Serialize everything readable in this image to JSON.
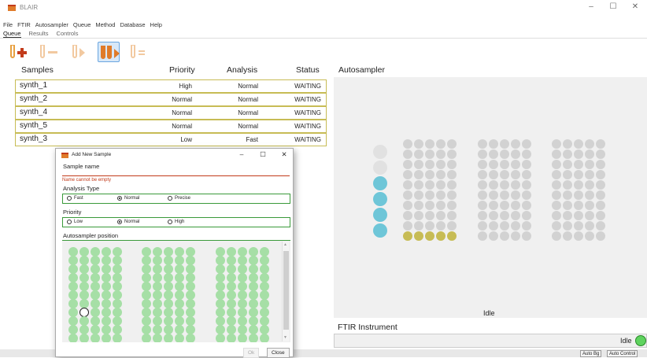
{
  "window": {
    "title": "BLAIR"
  },
  "menu": [
    "File",
    "FTIR",
    "Autosampler",
    "Queue",
    "Method",
    "Database",
    "Help"
  ],
  "tabs": [
    {
      "label": "Queue",
      "active": true
    },
    {
      "label": "Results",
      "active": false
    },
    {
      "label": "Controls",
      "active": false
    }
  ],
  "toolbar": {
    "buttons": [
      "add-sample",
      "remove-sample",
      "run-next",
      "run-all",
      "method"
    ],
    "selected": "run-all"
  },
  "queue_table": {
    "headers": {
      "samples": "Samples",
      "priority": "Priority",
      "analysis": "Analysis",
      "status": "Status"
    },
    "rows": [
      {
        "name": "synth_1",
        "priority": "High",
        "analysis": "Normal",
        "status": "WAITING"
      },
      {
        "name": "synth_2",
        "priority": "Normal",
        "analysis": "Normal",
        "status": "WAITING"
      },
      {
        "name": "synth_4",
        "priority": "Normal",
        "analysis": "Normal",
        "status": "WAITING"
      },
      {
        "name": "synth_5",
        "priority": "Normal",
        "analysis": "Normal",
        "status": "WAITING"
      },
      {
        "name": "synth_3",
        "priority": "Low",
        "analysis": "Fast",
        "status": "WAITING"
      }
    ]
  },
  "autosampler": {
    "title": "Autosampler",
    "status": "Idle",
    "colors": {
      "empty": "#d2d2d2",
      "large_empty": "#e1e1e1",
      "large_filled": "#6ec6d8",
      "queued": "#c7bc55"
    }
  },
  "ftir": {
    "title": "FTIR Instrument",
    "status": "Idle",
    "status_color": "#5fd35f"
  },
  "status_buttons": [
    "Auto Bg",
    "Auto Control"
  ],
  "dialog": {
    "title": "Add New Sample",
    "sample_name_label": "Sample name",
    "sample_name_value": "",
    "error": "Name cannot be empty",
    "analysis_label": "Analysis Type",
    "analysis_options": [
      "Fast",
      "Normal",
      "Precise"
    ],
    "analysis_selected": "Normal",
    "priority_label": "Priority",
    "priority_options": [
      "Low",
      "Normal",
      "High"
    ],
    "priority_selected": "Normal",
    "position_label": "Autosampler position",
    "position_color": "#a6dfa6",
    "ok_label": "Ok",
    "close_label": "Close"
  }
}
